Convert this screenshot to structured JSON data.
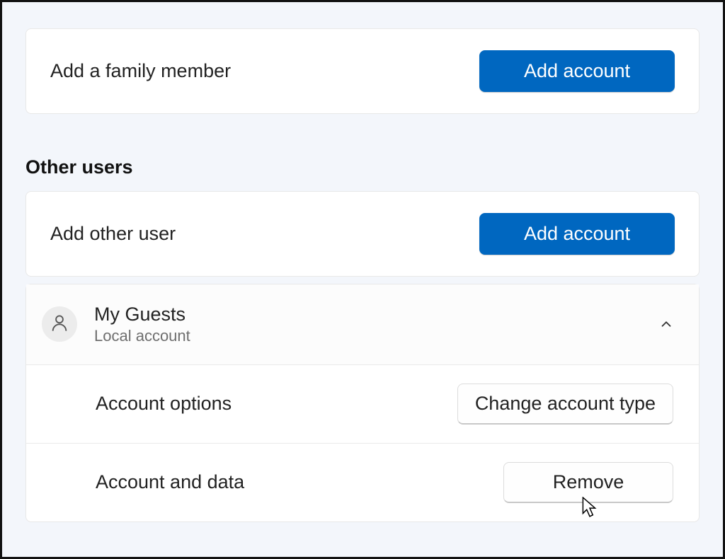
{
  "family": {
    "add_label": "Add a family member",
    "add_button": "Add account"
  },
  "other_users": {
    "section_title": "Other users",
    "add_label": "Add other user",
    "add_button": "Add account",
    "accounts": [
      {
        "name": "My Guests",
        "type": "Local account",
        "options_label": "Account options",
        "change_type_button": "Change account type",
        "data_label": "Account and data",
        "remove_button": "Remove"
      }
    ]
  },
  "colors": {
    "primary": "#0067c0",
    "background": "#f3f6fb"
  }
}
